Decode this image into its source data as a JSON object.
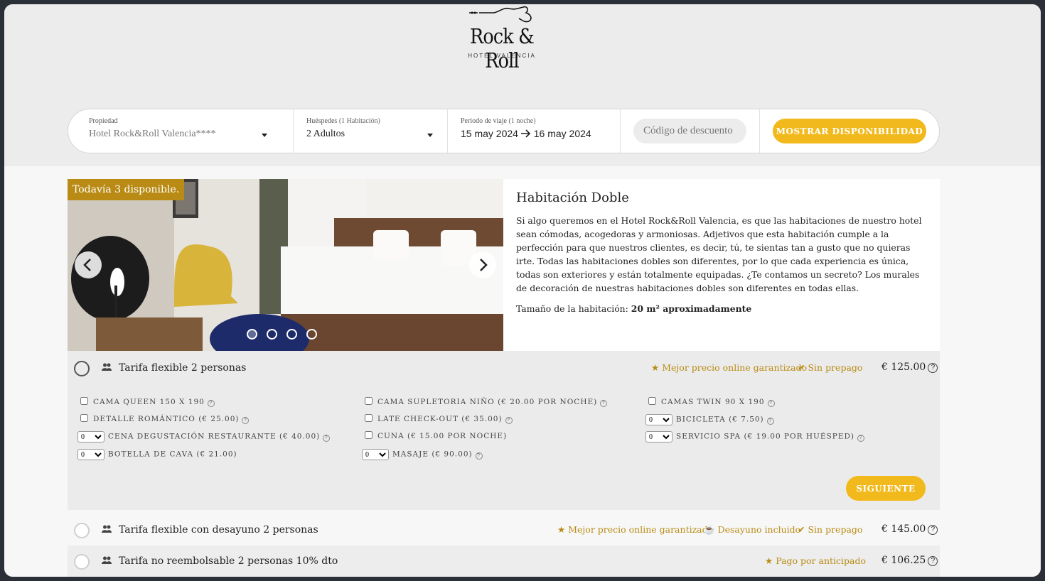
{
  "brand": {
    "name": "Rock & Roll",
    "subtitle": "HOTEL VALENCIA"
  },
  "search": {
    "property_label": "Propiedad",
    "property_value": "Hotel Rock&Roll Valencia****",
    "guests_label": "Huéspedes",
    "guests_sub": "(1 Habitación)",
    "guests_value": "2 Adultos",
    "period_label": "Periodo de viaje",
    "period_sub": "(1 noche)",
    "date_from": "15 may 2024",
    "date_to": "16 may 2024",
    "promo_placeholder": "Código de descuento",
    "show_button": "MOSTRAR DISPONIBILIDAD"
  },
  "room": {
    "availability": "Todavía 3 disponible.",
    "title": "Habitación Doble",
    "description": "Si algo queremos en el Hotel Rock&Roll Valencia, es que las habitaciones de nuestro hotel sean cómodas, acogedoras y armoniosas. Adjetivos que esta habitación cumple a la perfección para que nuestros clientes, es decir, tú, te sientas tan a gusto que no quieras irte. Todas las habitaciones dobles son diferentes, por lo que cada experiencia es única, todas son exteriores y están totalmente equipadas. ¿Te contamos un secreto? Los murales de decoración de nuestras habitaciones dobles son diferentes en todas ellas.",
    "size_label": "Tamaño de la habitación:",
    "size_value": "20 m² aproximadamente",
    "carousel_dots": 4,
    "carousel_active": 1
  },
  "rates": [
    {
      "name": "Tarifa flexible 2 personas",
      "badge1": "Mejor precio online garantizado",
      "badge2": "Sin prepago",
      "price": "€ 125.00",
      "extras": {
        "col1": [
          "CAMA QUEEN 150 X 190",
          "DETALLE ROMÁNTICO (€ 25.00)",
          "CENA DEGUSTACIÓN RESTAURANTE (€ 40.00)",
          "BOTELLA DE CAVA (€ 21.00)"
        ],
        "col2": [
          "CAMA SUPLETORIA NIÑO (€ 20.00 POR NOCHE)",
          "LATE CHECK-OUT (€ 35.00)",
          "CUNA (€ 15.00 POR NOCHE)",
          "MASAJE (€ 90.00)"
        ],
        "col3": [
          "CAMAS TWIN 90 X 190",
          "BICICLETA (€ 7.50)",
          "SERVICIO SPA (€ 19.00 POR HUÉSPED)"
        ],
        "select_value": "0"
      },
      "next_button": "SIGUIENTE"
    },
    {
      "name": "Tarifa flexible con desayuno 2 personas",
      "badge1": "Mejor precio online garantizado",
      "badge2": "Desayuno incluido",
      "badge3": "Sin prepago",
      "price": "€ 145.00"
    },
    {
      "name": "Tarifa no reembolsable 2 personas 10% dto",
      "badge1": "Pago por anticipado",
      "price": "€ 106.25"
    }
  ],
  "colors": {
    "accent": "#f2b91c",
    "gold_text": "#b98b14",
    "badge_bg": "#b98b14"
  }
}
